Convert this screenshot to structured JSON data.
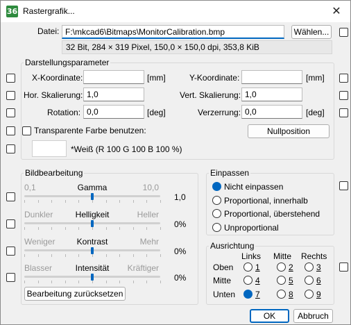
{
  "window": {
    "app_icon_text": "36",
    "title": "Rastergrafik...",
    "close_glyph": "✕"
  },
  "file": {
    "label": "Datei:",
    "path": "F:\\mkcad6\\Bitmaps\\MonitorCalibration.bmp",
    "browse_label": "Wählen...",
    "info": "32 Bit, 284 × 319 Pixel, 150,0 × 150,0 dpi, 353,8 KiB"
  },
  "display": {
    "group_title": "Darstellungsparameter",
    "x_label": "X-Koordinate:",
    "x_value": "",
    "x_unit": "[mm]",
    "y_label": "Y-Koordinate:",
    "y_value": "",
    "y_unit": "[mm]",
    "hscale_label": "Hor. Skalierung:",
    "hscale_value": "1,0",
    "vscale_label": "Vert. Skalierung:",
    "vscale_value": "1,0",
    "rotation_label": "Rotation:",
    "rotation_value": "0,0",
    "rotation_unit": "[deg]",
    "distortion_label": "Verzerrung:",
    "distortion_value": "0,0",
    "distortion_unit": "[deg]",
    "transparent_label": "Transparente Farbe benutzen:",
    "zero_button": "Nullposition",
    "color_caption": "*Weiß (R 100 G 100 B 100 %)",
    "color_hex": "#ffffff"
  },
  "edit": {
    "group_title": "Bildbearbeitung",
    "sliders": [
      {
        "left": "0,1",
        "name": "Gamma",
        "right": "10,0",
        "value": "1,0",
        "position": 0.5
      },
      {
        "left": "Dunkler",
        "name": "Helligkeit",
        "right": "Heller",
        "value": "0%",
        "position": 0.5
      },
      {
        "left": "Weniger",
        "name": "Kontrast",
        "right": "Mehr",
        "value": "0%",
        "position": 0.5
      },
      {
        "left": "Blasser",
        "name": "Intensität",
        "right": "Kräftiger",
        "value": "0%",
        "position": 0.5
      }
    ],
    "reset_button": "Bearbeitung zurücksetzen"
  },
  "fit": {
    "group_title": "Einpassen",
    "options": [
      "Nicht einpassen",
      "Proportional, innerhalb",
      "Proportional, überstehend",
      "Unproportional"
    ],
    "selected": 0
  },
  "align": {
    "group_title": "Ausrichtung",
    "col_headers": [
      "Links",
      "Mitte",
      "Rechts"
    ],
    "row_headers": [
      "Oben",
      "Mitte",
      "Unten"
    ],
    "cells": [
      "1",
      "2",
      "3",
      "4",
      "5",
      "6",
      "7",
      "8",
      "9"
    ],
    "selected": 6
  },
  "buttons": {
    "ok": "OK",
    "cancel": "Abbruch"
  },
  "colors": {
    "accent": "#0067c0",
    "app_icon": "#2e8b3e"
  }
}
